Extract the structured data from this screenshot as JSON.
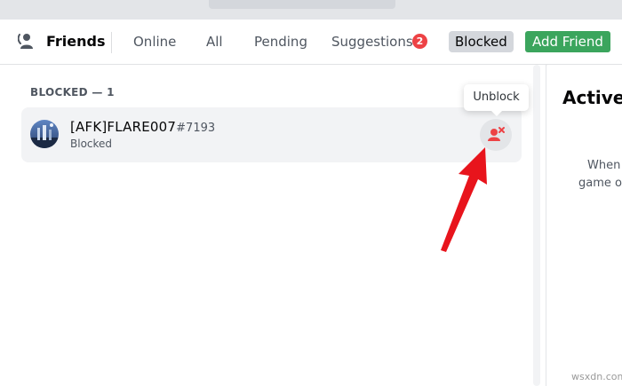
{
  "header": {
    "title": "Friends",
    "tabs": {
      "online": "Online",
      "all": "All",
      "pending": "Pending",
      "suggestions": "Suggestions",
      "blocked": "Blocked"
    },
    "suggestions_badge": "2",
    "add_friend_label": "Add Friend"
  },
  "main": {
    "section_label": "BLOCKED — 1",
    "friends": [
      {
        "username": "[AFK]FLARE007",
        "discriminator": "#7193",
        "status": "Blocked"
      }
    ],
    "tooltip": "Unblock"
  },
  "side_panel": {
    "title": "Active",
    "text_line1": "When",
    "text_line2": "game or"
  },
  "watermark": "wsxdn.com",
  "colors": {
    "accent_green": "#3ba55d",
    "badge_red": "#ed4245",
    "unblock_icon": "#ed4245",
    "annotation_arrow": "#e8141c"
  },
  "icons": {
    "friends": "friends-wave-icon",
    "unblock": "user-remove-icon"
  }
}
